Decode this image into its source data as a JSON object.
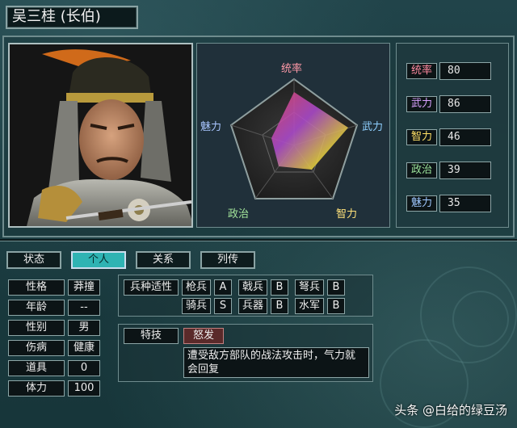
{
  "title": "吴三桂 (长伯)",
  "radar": {
    "labels": {
      "top": "统率",
      "left": "魅力",
      "right": "武力",
      "bottom_left": "政治",
      "bottom_right": "智力"
    },
    "label_colors": {
      "top": "#ff9aa8",
      "left": "#a9c6ff",
      "right": "#8fd0ff",
      "bottom_left": "#a3e59b",
      "bottom_right": "#ffe27a"
    }
  },
  "stats": [
    {
      "name": "统率",
      "value": "80",
      "color": "#ff8aa0"
    },
    {
      "name": "武力",
      "value": "86",
      "color": "#d9a1ff"
    },
    {
      "name": "智力",
      "value": "46",
      "color": "#ffe066"
    },
    {
      "name": "政治",
      "value": "39",
      "color": "#9be39b"
    },
    {
      "name": "魅力",
      "value": "35",
      "color": "#9ec7ff"
    }
  ],
  "tabs": [
    {
      "label": "状态"
    },
    {
      "label": "个人",
      "active": true
    },
    {
      "label": "关系"
    },
    {
      "label": "列传"
    }
  ],
  "info": {
    "rows": [
      {
        "label": "性格",
        "value": "莽撞"
      },
      {
        "label": "年龄",
        "value": "--"
      },
      {
        "label": "性别",
        "value": "男"
      },
      {
        "label": "伤病",
        "value": "健康"
      },
      {
        "label": "道具",
        "value": "0"
      },
      {
        "label": "体力",
        "value": "100"
      }
    ]
  },
  "aptitude": {
    "header": "兵种适性",
    "items": [
      {
        "name": "枪兵",
        "grade": "A"
      },
      {
        "name": "戟兵",
        "grade": "B"
      },
      {
        "name": "弩兵",
        "grade": "B"
      },
      {
        "name": "骑兵",
        "grade": "S"
      },
      {
        "name": "兵器",
        "grade": "B"
      },
      {
        "name": "水军",
        "grade": "B"
      }
    ]
  },
  "skill": {
    "label": "特技",
    "name": "怒发",
    "description": "遭受敌方部队的战法攻击时，气力就会回复"
  },
  "watermark": "头条 @白给的绿豆汤"
}
